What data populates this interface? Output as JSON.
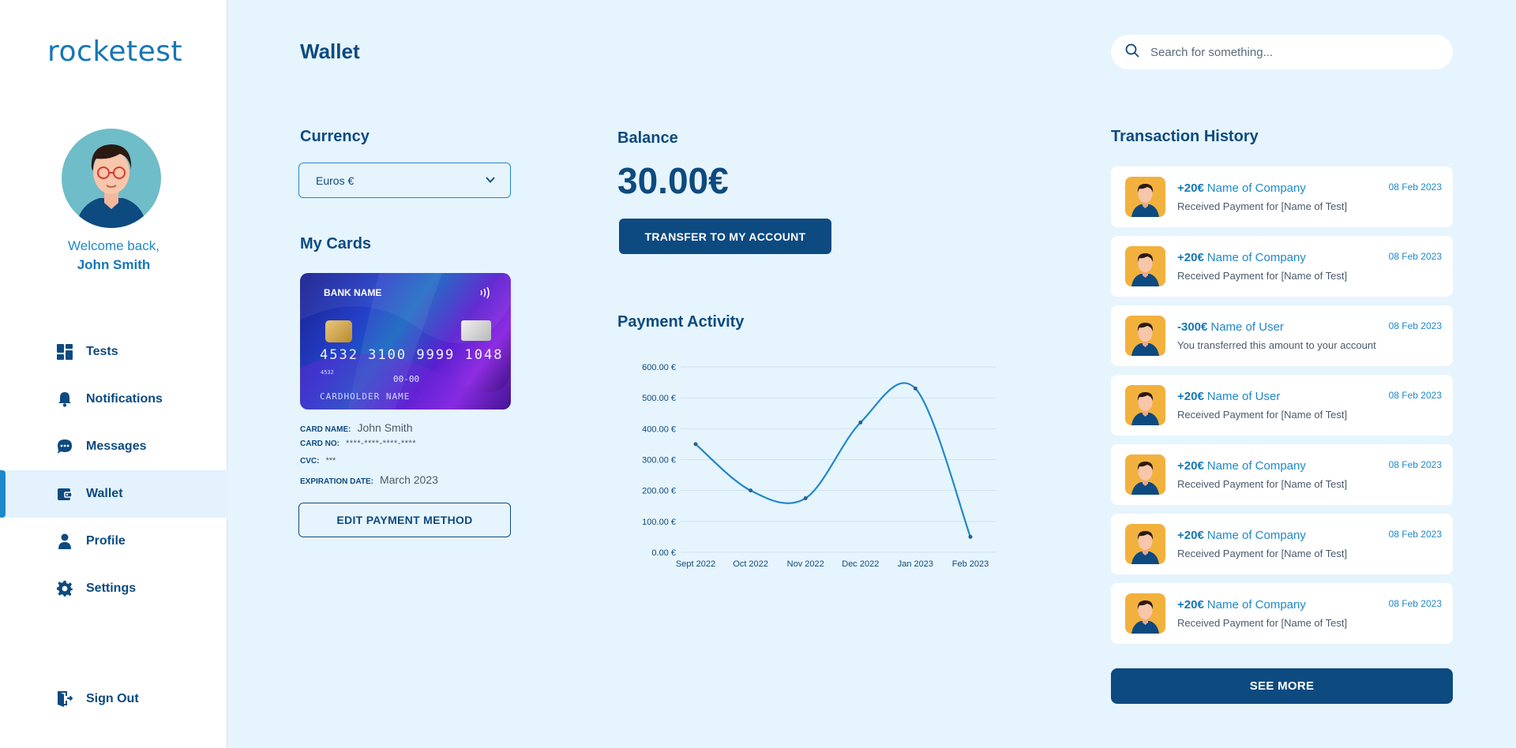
{
  "app": {
    "logo_text": "rocketest"
  },
  "user": {
    "welcome": "Welcome back,",
    "name": "John Smith"
  },
  "nav": {
    "items": [
      {
        "label": "Tests",
        "icon": "dashboard-icon"
      },
      {
        "label": "Notifications",
        "icon": "bell-icon"
      },
      {
        "label": "Messages",
        "icon": "chat-icon"
      },
      {
        "label": "Wallet",
        "icon": "wallet-icon",
        "active": true
      },
      {
        "label": "Profile",
        "icon": "person-icon"
      },
      {
        "label": "Settings",
        "icon": "gear-icon"
      }
    ],
    "sign_out": "Sign Out"
  },
  "header": {
    "title": "Wallet",
    "search_placeholder": "Search for something..."
  },
  "currency": {
    "title": "Currency",
    "selected": "Euros €"
  },
  "cards": {
    "title": "My Cards",
    "card_visual": {
      "bank_name": "BANK NAME",
      "number": "4532 3100 9999 1048",
      "small_number": "4532",
      "expiry": "00-00",
      "holder": "CARDHOLDER NAME"
    },
    "card_name_label": "CARD NAME:",
    "card_name": "John Smith",
    "card_no_label": "CARD NO:",
    "card_no": "****-****-****-****",
    "cvc_label": "CVC:",
    "cvc": "***",
    "expiration_label": "EXPIRATION DATE:",
    "expiration": "March 2023",
    "edit_button": "EDIT PAYMENT METHOD"
  },
  "balance": {
    "title": "Balance",
    "amount": "30.00€",
    "transfer_button": "TRANSFER TO MY ACCOUNT"
  },
  "activity": {
    "title": "Payment Activity"
  },
  "chart_data": {
    "type": "line",
    "categories": [
      "Sept 2022",
      "Oct 2022",
      "Nov 2022",
      "Dec 2022",
      "Jan 2023",
      "Feb 2023"
    ],
    "values": [
      350,
      200,
      175,
      420,
      530,
      50
    ],
    "ylim": [
      0,
      600
    ],
    "yticks": [
      0,
      100,
      200,
      300,
      400,
      500,
      600
    ],
    "ytick_labels": [
      "0.00 €",
      "100.00 €",
      "200.00 €",
      "300.00 €",
      "400.00 €",
      "500.00 €",
      "600.00 €"
    ],
    "grid": true,
    "color": "#1f88c9"
  },
  "transactions": {
    "title": "Transaction History",
    "items": [
      {
        "amount": "+20€",
        "name": "Name of Company",
        "desc": "Received Payment for [Name of Test]",
        "date": "08 Feb 2023"
      },
      {
        "amount": "+20€",
        "name": "Name of Company",
        "desc": "Received Payment for [Name of Test]",
        "date": "08 Feb 2023"
      },
      {
        "amount": "-300€",
        "name": "Name of User",
        "desc": "You transferred this amount to your account",
        "date": "08 Feb 2023"
      },
      {
        "amount": "+20€",
        "name": "Name of User",
        "desc": "Received Payment for [Name of Test]",
        "date": "08 Feb 2023"
      },
      {
        "amount": "+20€",
        "name": "Name of Company",
        "desc": "Received Payment for [Name of Test]",
        "date": "08 Feb 2023"
      },
      {
        "amount": "+20€",
        "name": "Name of Company",
        "desc": "Received Payment for [Name of Test]",
        "date": "08 Feb 2023"
      },
      {
        "amount": "+20€",
        "name": "Name of Company",
        "desc": "Received Payment for [Name of Test]",
        "date": "08 Feb 2023"
      }
    ],
    "see_more": "SEE MORE"
  },
  "colors": {
    "primary": "#0d4a80",
    "accent": "#1f88c9",
    "background": "#e6f4fd",
    "avatar_bg": "#f2b13d"
  }
}
